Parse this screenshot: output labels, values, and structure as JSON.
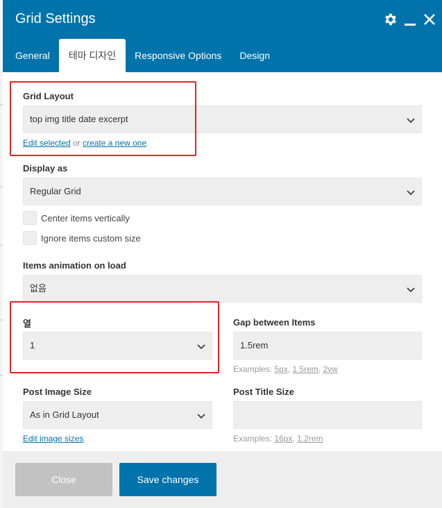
{
  "window": {
    "title": "Grid Settings",
    "icons": [
      "gear-icon",
      "minimize-icon",
      "close-icon"
    ]
  },
  "tabs": [
    {
      "label": "General"
    },
    {
      "label": "테마 디자인"
    },
    {
      "label": "Responsive Options"
    },
    {
      "label": "Design"
    }
  ],
  "active_tab": "테마 디자인",
  "grid_layout": {
    "label": "Grid Layout",
    "value": "top img title date excerpt",
    "edit_link": "Edit selected",
    "or_text": "or",
    "create_link": "create a new one",
    "period": "."
  },
  "display_as": {
    "label": "Display as",
    "value": "Regular Grid"
  },
  "checkboxes": {
    "center": "Center items vertically",
    "ignore": "Ignore items custom size"
  },
  "animation": {
    "label": "Items animation on load",
    "value": "없음"
  },
  "columns": {
    "label": "열",
    "value": "1"
  },
  "gap": {
    "label": "Gap between Items",
    "value": "1.5rem",
    "hint_prefix": "Examples:",
    "ex1": "5px",
    "ex2": "1.5rem",
    "ex3": "2vw",
    "sep": ","
  },
  "post_image_size": {
    "label": "Post Image Size",
    "value": "As in Grid Layout",
    "link": "Edit image sizes",
    "period": "."
  },
  "post_title_size": {
    "label": "Post Title Size",
    "value": "",
    "hint_prefix": "Examples:",
    "ex1": "16px",
    "ex2": "1.2rem",
    "sep": ","
  },
  "footer": {
    "close_label": "Close",
    "save_label": "Save changes"
  },
  "colors": {
    "header": "#0073aa",
    "highlight_box": "#e02424",
    "save_button": "#0073aa",
    "close_button": "#c2c2c2"
  }
}
